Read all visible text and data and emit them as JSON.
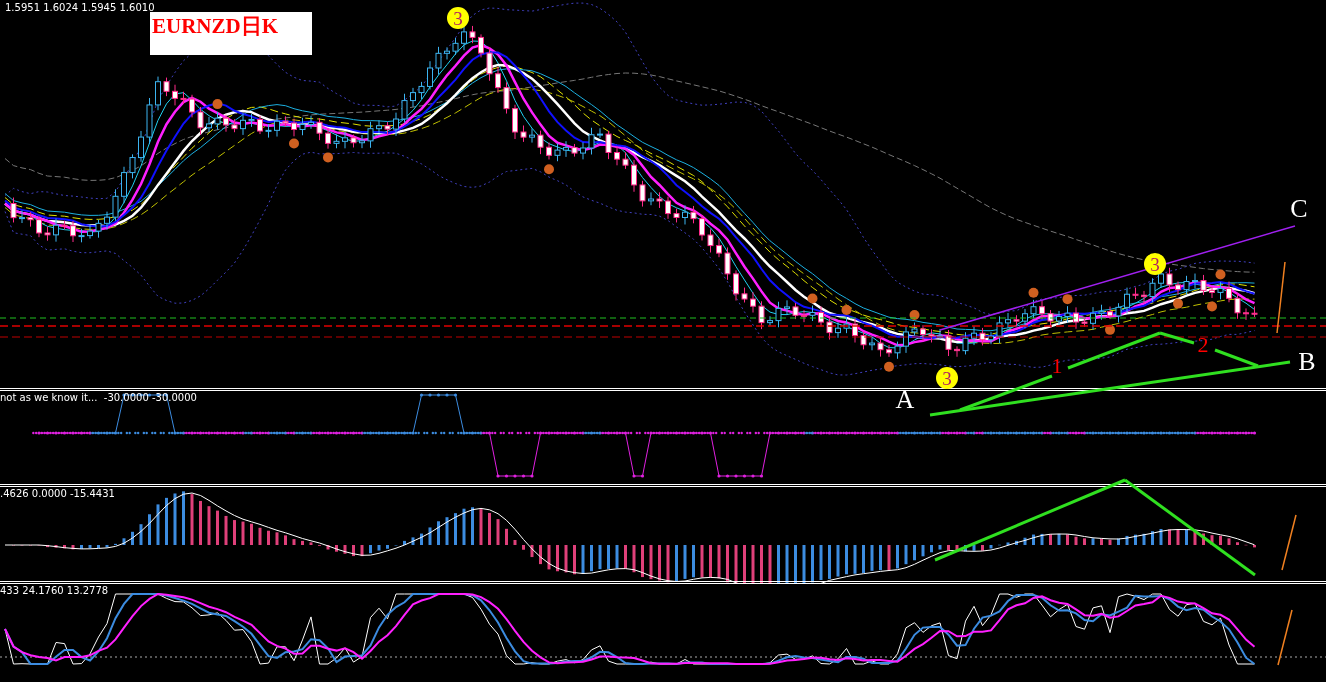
{
  "chart": {
    "quote": "1.5951 1.6024 1.5945 1.6010",
    "title": "EURNZD日K"
  },
  "panes": [
    {
      "kind": "steps",
      "label": "not as we know it...  -30.0000 -30.0000"
    },
    {
      "kind": "histogram",
      "label": ".4626 0.0000 -15.4431"
    },
    {
      "kind": "oscillator",
      "label": "433 24.1760 13.2778"
    }
  ],
  "annotations": [
    {
      "kind": "badge",
      "text": "3"
    },
    {
      "kind": "badge",
      "text": "3"
    },
    {
      "kind": "badge",
      "text": "3"
    },
    {
      "kind": "letter",
      "text": "A"
    },
    {
      "kind": "letter",
      "text": "B"
    },
    {
      "kind": "letter",
      "text": "C"
    },
    {
      "kind": "number",
      "text": "1"
    },
    {
      "kind": "number",
      "text": "2"
    }
  ]
}
